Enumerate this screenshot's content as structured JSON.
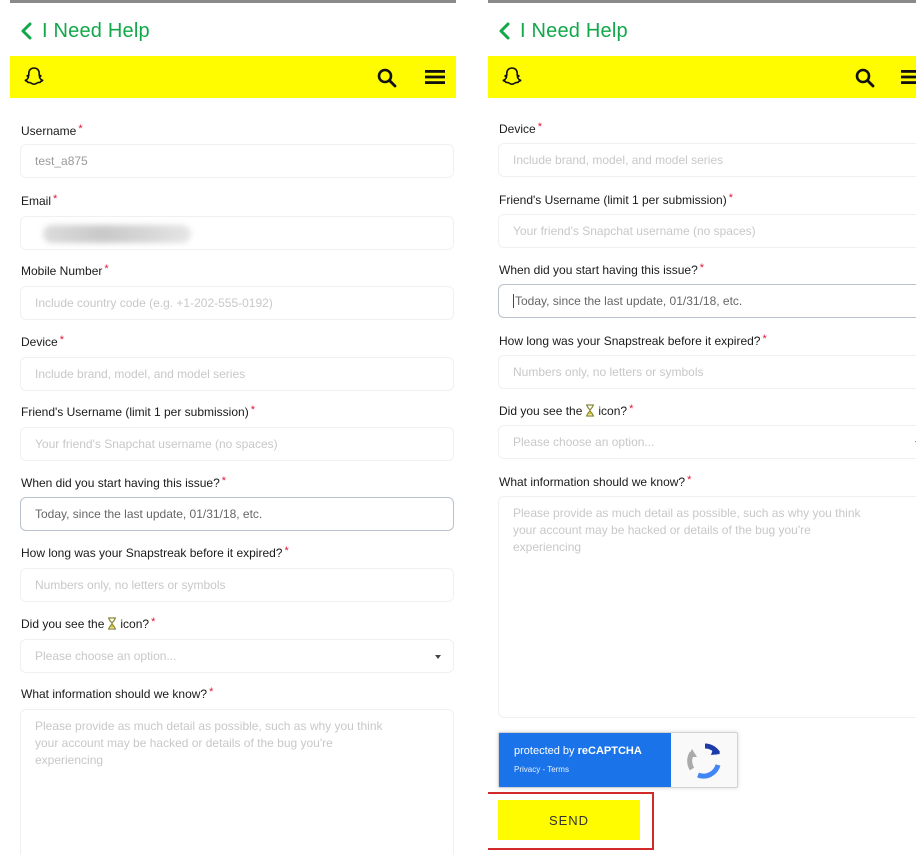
{
  "header": {
    "back_label": "I Need Help"
  },
  "colors": {
    "brand_yellow": "#fffc00",
    "help_green": "#11a84a",
    "required_red": "#e0153b",
    "recaptcha_blue": "#1a73e8",
    "highlight_red": "#d22a2a"
  },
  "icons": {
    "back": "chevron-left-icon",
    "logo": "snapchat-ghost-icon",
    "search": "search-icon",
    "menu": "hamburger-menu-icon",
    "hourglass": "hourglass-icon",
    "recaptcha": "recaptcha-logo-icon",
    "select": "caret-down-icon"
  },
  "form": {
    "required_mark": "*",
    "username": {
      "label": "Username",
      "value": "test_a875"
    },
    "email": {
      "label": "Email"
    },
    "mobile": {
      "label": "Mobile Number",
      "placeholder": "Include country code (e.g. +1-202-555-0192)"
    },
    "device": {
      "label": "Device",
      "placeholder": "Include brand, model, and model series"
    },
    "friend": {
      "label": "Friend's Username (limit 1 per submission)",
      "placeholder": "Your friend's Snapchat username (no spaces)"
    },
    "issue_start": {
      "label": "When did you start having this issue?",
      "placeholder": "Today, since the last update, 01/31/18, etc."
    },
    "streak_length": {
      "label": "How long was your Snapstreak before it expired?",
      "placeholder": "Numbers only, no letters or symbols"
    },
    "icon_seen": {
      "label_before": "Did you see the",
      "label_after": "icon?",
      "placeholder": "Please choose an option..."
    },
    "info": {
      "label": "What information should we know?",
      "placeholder": "Please provide as much detail as possible, such as why you think\nyour account may be hacked or details of the bug you're\nexperiencing"
    }
  },
  "recaptcha": {
    "protected_by": "protected by",
    "brand": "reCAPTCHA",
    "links": "Privacy - Terms"
  },
  "send_label": "SEND"
}
